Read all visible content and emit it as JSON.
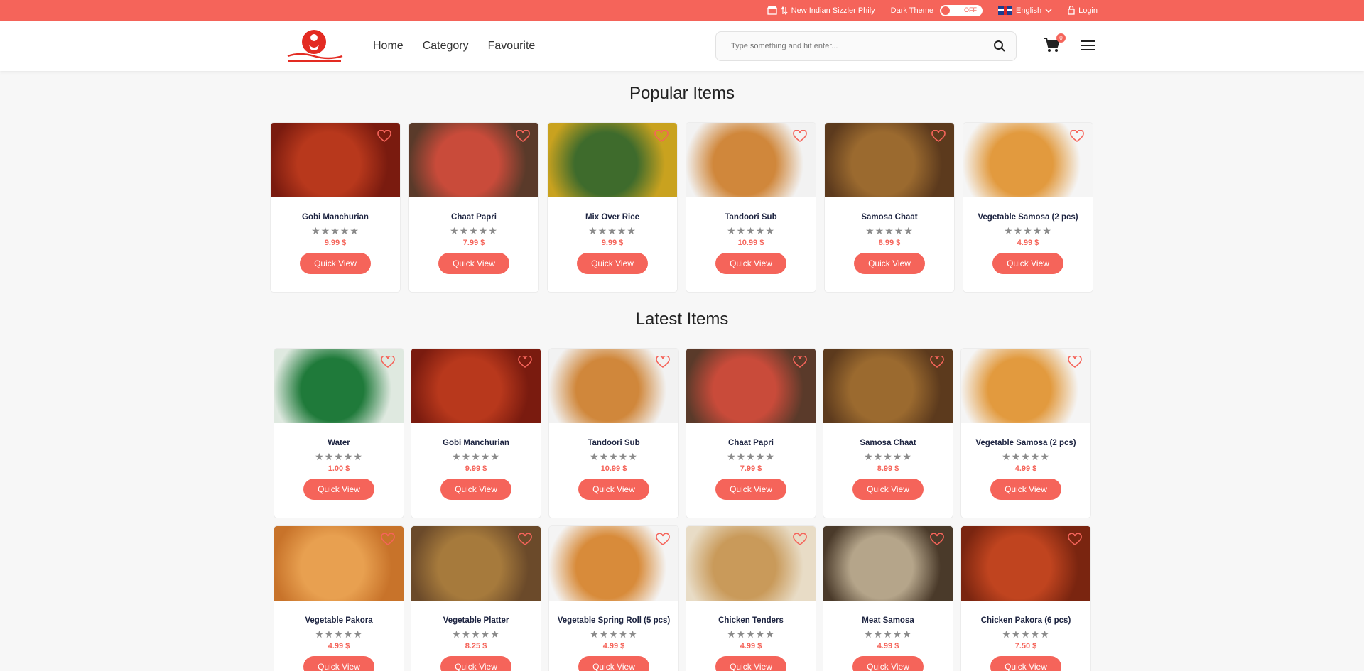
{
  "topbar": {
    "store": "New Indian Sizzler Phily",
    "dark_theme_label": "Dark Theme",
    "dark_theme_state": "OFF",
    "language": "English",
    "login": "Login"
  },
  "header": {
    "nav": [
      "Home",
      "Category",
      "Favourite"
    ],
    "search_placeholder": "Type something and hit enter...",
    "cart_count": "0"
  },
  "sections": {
    "popular_title": "Popular Items",
    "latest_title": "Latest Items"
  },
  "popular_items": [
    {
      "name": "Gobi Manchurian",
      "price": "9.99 $",
      "quick_view": "Quick View",
      "palette": [
        "#7a1b0f",
        "#b8381c"
      ]
    },
    {
      "name": "Chaat Papri",
      "price": "7.99 $",
      "quick_view": "Quick View",
      "palette": [
        "#5a3a2a",
        "#c94b3a"
      ]
    },
    {
      "name": "Mix Over Rice",
      "price": "9.99 $",
      "quick_view": "Quick View",
      "palette": [
        "#c9a21f",
        "#3e6b2c"
      ]
    },
    {
      "name": "Tandoori Sub",
      "price": "10.99 $",
      "quick_view": "Quick View",
      "palette": [
        "#f2f2f2",
        "#d0873b"
      ]
    },
    {
      "name": "Samosa Chaat",
      "price": "8.99 $",
      "quick_view": "Quick View",
      "palette": [
        "#5c3a1d",
        "#9b6a2f"
      ]
    },
    {
      "name": "Vegetable Samosa (2 pcs)",
      "price": "4.99 $",
      "quick_view": "Quick View",
      "palette": [
        "#f5f5f5",
        "#e29a3e"
      ]
    }
  ],
  "latest_items": [
    {
      "name": "Water",
      "price": "1.00 $",
      "quick_view": "Quick View",
      "palette": [
        "#dfe9e0",
        "#1f7a3a"
      ]
    },
    {
      "name": "Gobi Manchurian",
      "price": "9.99 $",
      "quick_view": "Quick View",
      "palette": [
        "#7a1b0f",
        "#b8381c"
      ]
    },
    {
      "name": "Tandoori Sub",
      "price": "10.99 $",
      "quick_view": "Quick View",
      "palette": [
        "#f2f2f2",
        "#d0873b"
      ]
    },
    {
      "name": "Chaat Papri",
      "price": "7.99 $",
      "quick_view": "Quick View",
      "palette": [
        "#5a3a2a",
        "#c94b3a"
      ]
    },
    {
      "name": "Samosa Chaat",
      "price": "8.99 $",
      "quick_view": "Quick View",
      "palette": [
        "#5c3a1d",
        "#9b6a2f"
      ]
    },
    {
      "name": "Vegetable Samosa (2 pcs)",
      "price": "4.99 $",
      "quick_view": "Quick View",
      "palette": [
        "#f5f5f5",
        "#e29a3e"
      ]
    },
    {
      "name": "Vegetable Pakora",
      "price": "4.99 $",
      "quick_view": "Quick View",
      "palette": [
        "#c8732a",
        "#e8a050"
      ]
    },
    {
      "name": "Vegetable Platter",
      "price": "8.25 $",
      "quick_view": "Quick View",
      "palette": [
        "#6b4a2a",
        "#a67a3c"
      ]
    },
    {
      "name": "Vegetable Spring Roll (5 pcs)",
      "price": "4.99 $",
      "quick_view": "Quick View",
      "palette": [
        "#f4f4f4",
        "#d88b3a"
      ]
    },
    {
      "name": "Chicken Tenders",
      "price": "4.99 $",
      "quick_view": "Quick View",
      "palette": [
        "#e8dcc6",
        "#c99a5a"
      ]
    },
    {
      "name": "Meat Samosa",
      "price": "4.99 $",
      "quick_view": "Quick View",
      "palette": [
        "#4a3a2a",
        "#b5a58a"
      ]
    },
    {
      "name": "Chicken Pakora (6 pcs)",
      "price": "7.50 $",
      "quick_view": "Quick View",
      "palette": [
        "#7a2510",
        "#c0441f"
      ]
    }
  ],
  "accent_color": "#f5645a"
}
